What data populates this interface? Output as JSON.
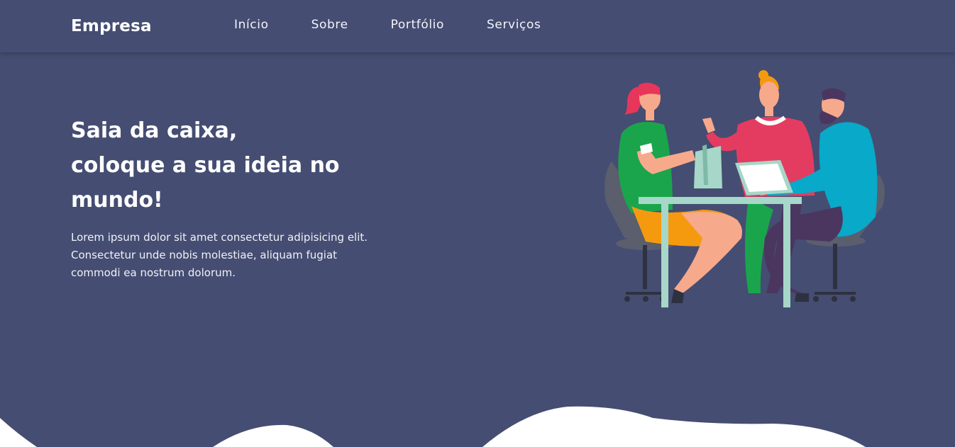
{
  "navbar": {
    "brand": "Empresa",
    "links": [
      "Início",
      "Sobre",
      "Portfólio",
      "Serviços"
    ]
  },
  "hero": {
    "title_lines": [
      "Saia da caixa,",
      "coloque a sua ideia no",
      "mundo!"
    ],
    "text": "Lorem ipsum dolor sit amet consectetur adipisicing elit. Consectetur unde nobis molestiae, aliquam fugiat commodi ea nostrum dolorum."
  },
  "colors": {
    "background": "#454d72",
    "text": "#ffffff",
    "wave": "#ffffff"
  },
  "illustration": {
    "icon": "team-meeting-illustration"
  }
}
